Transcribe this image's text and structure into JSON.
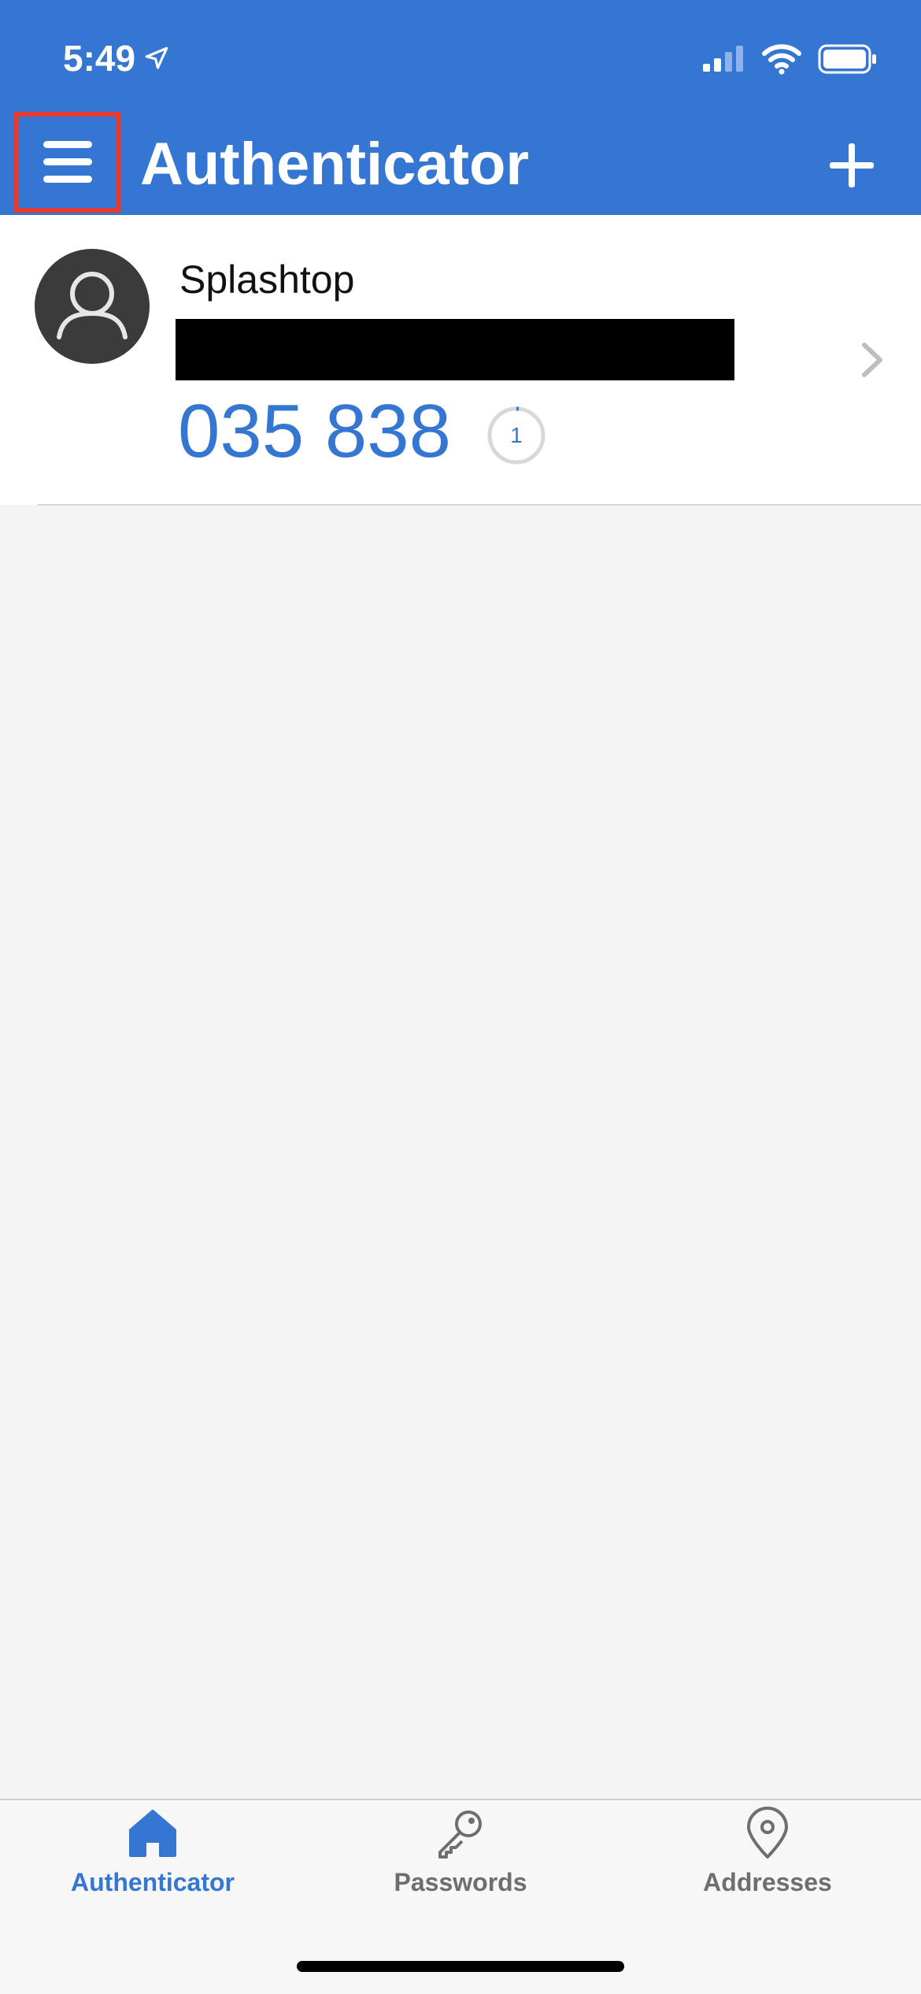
{
  "status_bar": {
    "time": "5:49",
    "location_icon": "location-arrow-icon",
    "signal_icon": "cellular-signal-icon",
    "wifi_icon": "wifi-icon",
    "battery_icon": "battery-icon"
  },
  "header": {
    "title": "Authenticator",
    "menu_icon": "hamburger-menu-icon",
    "add_icon": "plus-icon",
    "background_color": "#3576d2",
    "highlight_color": "#e53a2f"
  },
  "account": {
    "name": "Splashtop",
    "code": "035 838",
    "timer_seconds": "1",
    "avatar_icon": "person-icon",
    "chevron_icon": "chevron-right-icon",
    "code_color": "#3576d2"
  },
  "tabs": [
    {
      "label": "Authenticator",
      "icon": "home-icon",
      "active": true,
      "color": "#3576d2"
    },
    {
      "label": "Passwords",
      "icon": "key-icon",
      "active": false,
      "color": "#6e6e6e"
    },
    {
      "label": "Addresses",
      "icon": "map-pin-icon",
      "active": false,
      "color": "#6e6e6e"
    }
  ]
}
